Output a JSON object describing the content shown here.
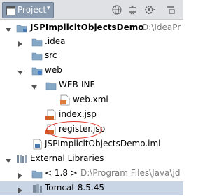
{
  "toolbar": {
    "tab_label": "Project",
    "tab_caret": "▾",
    "icons": [
      "globe-icon",
      "collapse-icon",
      "settings-icon",
      "hide-icon"
    ]
  },
  "tree": {
    "root": {
      "label": "JSPImplicitObjectsDemo",
      "path": "D:\\IdeaPr"
    },
    "idea": ".idea",
    "src": "src",
    "web": "web",
    "webinf": "WEB-INF",
    "webxml": "web.xml",
    "index": "index.jsp",
    "register": "register.jsp",
    "iml": "JSPImplicitObjectsDemo.iml",
    "ext_libs": "External Libraries",
    "jdk": {
      "label": "< 1.8 >",
      "path": "D:\\Program Files\\Java\\jd"
    },
    "tomcat": "Tomcat 8.5.45"
  },
  "colors": {
    "folder": "#86a8c7",
    "module_folder": "#4a7ab0",
    "jsp_badge": "#d3602b",
    "selection": "#c9d4e4",
    "annotation_circle": "#e0342a"
  }
}
